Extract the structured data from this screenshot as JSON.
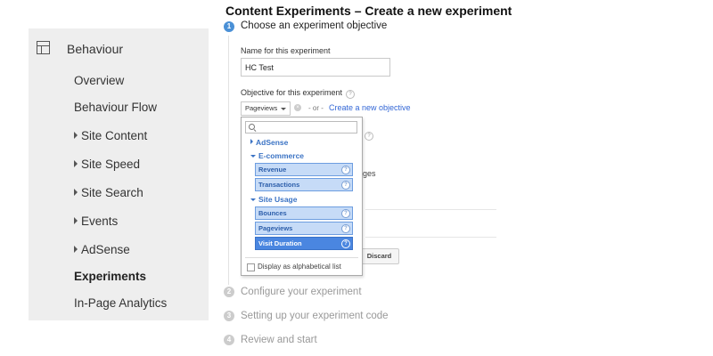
{
  "sidebar": {
    "header": {
      "label": "Behaviour",
      "icon": "layout-icon"
    },
    "items": [
      {
        "label": "Overview",
        "expandable": false,
        "bold": false
      },
      {
        "label": "Behaviour Flow",
        "expandable": false,
        "bold": false
      },
      {
        "label": "Site Content",
        "expandable": true,
        "bold": false
      },
      {
        "label": "Site Speed",
        "expandable": true,
        "bold": false
      },
      {
        "label": "Site Search",
        "expandable": true,
        "bold": false
      },
      {
        "label": "Events",
        "expandable": true,
        "bold": false
      },
      {
        "label": "AdSense",
        "expandable": true,
        "bold": false
      },
      {
        "label": "Experiments",
        "expandable": false,
        "bold": true
      },
      {
        "label": "In-Page Analytics",
        "expandable": false,
        "bold": false
      }
    ]
  },
  "main": {
    "title": "Content Experiments – Create a new experiment",
    "steps": [
      {
        "number": "1",
        "label": "Choose an experiment objective",
        "active": true
      },
      {
        "number": "2",
        "label": "Configure your experiment",
        "active": false
      },
      {
        "number": "3",
        "label": "Setting up your experiment code",
        "active": false
      },
      {
        "number": "4",
        "label": "Review and start",
        "active": false
      }
    ],
    "name_label": "Name for this experiment",
    "name_value": "HC Test",
    "objective_label": "Objective for this experiment",
    "objective_selected": "Pageviews",
    "or_text": "- or -",
    "create_link": "Create a new objective",
    "ghost_text": "ges",
    "discard_label": "Discard"
  },
  "dropdown": {
    "search_placeholder": "",
    "groups": [
      {
        "label": "AdSense",
        "expanded": false,
        "options": []
      },
      {
        "label": "E-commerce",
        "expanded": true,
        "options": [
          "Revenue",
          "Transactions"
        ]
      },
      {
        "label": "Site Usage",
        "expanded": true,
        "options": [
          "Bounces",
          "Pageviews",
          "Visit Duration"
        ]
      }
    ],
    "selected_option": "Visit Duration",
    "alphabetical_label": "Display as alphabetical list",
    "alphabetical_checked": false
  },
  "colors": {
    "sidebar_bg": "#eeeeee",
    "accent": "#4a90d6",
    "link": "#3367d6",
    "option_bg": "#c6dbf7",
    "option_selected_bg": "#4a86e0"
  }
}
